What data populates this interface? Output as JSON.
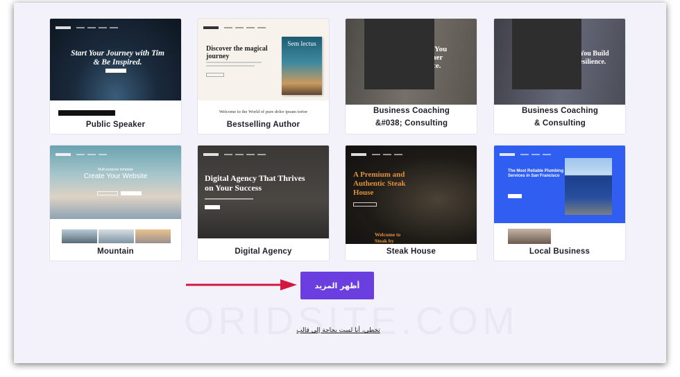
{
  "templates": [
    {
      "name": "Public Speaker",
      "headline": "Start Your Journey with Tim & Be Inspired."
    },
    {
      "name": "Bestselling Author",
      "headline": "Discover the magical journey",
      "book_title": "Sem lectus",
      "tagline": "Welcome to the World of pure dolor ipsum tortor"
    },
    {
      "name": "Business Coaching &#038; Consulting",
      "headline": "ng You\nInner\nence."
    },
    {
      "name": "Business Coaching & Consulting",
      "headline": "g You Build\nResilience."
    },
    {
      "name": "Mountain",
      "headline": "Create Your Website",
      "subheadline": "Multi-purpose template"
    },
    {
      "name": "Digital Agency",
      "headline": "Digital Agency That Thrives on Your Success"
    },
    {
      "name": "Steak House",
      "headline": "A Premium and Authentic Steak House",
      "welcome": "Welcome to Steak by"
    },
    {
      "name": "Local Business",
      "headline": "The Most Reliable Plumbing Services in San Francisco"
    }
  ],
  "show_more_label": "أظهر المزيد",
  "skip_link": "تخطي، أنا لست بحاجة إلى قالب",
  "watermark": "ORIDSITE.COM",
  "colors": {
    "accent": "#6b3ee0",
    "arrow": "#d3173f",
    "background": "#f3f2fb"
  }
}
